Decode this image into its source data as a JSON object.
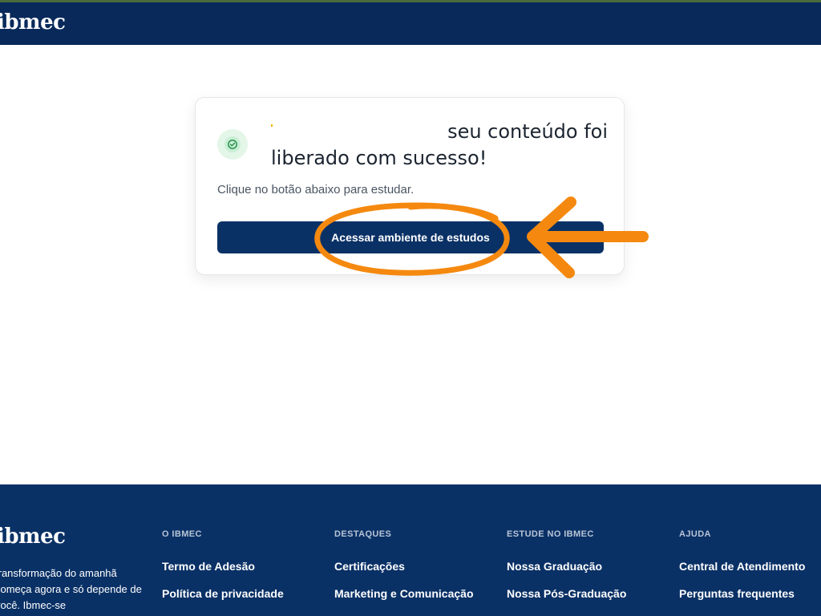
{
  "header": {
    "logo": "ibmec"
  },
  "card": {
    "title_line1": "seu conteúdo foi",
    "title_line2": "liberado com sucesso!",
    "subtitle": "Clique no botão abaixo para estudar.",
    "button_label": "Acessar ambiente de estudos",
    "icon": "check-circle-icon",
    "accent_color": "#0a3166"
  },
  "annotation": {
    "color": "#f5890f",
    "shapes": [
      "ellipse",
      "arrow"
    ]
  },
  "footer": {
    "logo": "ibmec",
    "tagline": "transformação do amanhã começa agora e só depende de você. Ibmec-se",
    "columns": [
      {
        "title": "O IBMEC",
        "links": [
          "Termo de Adesão",
          "Política de privacidade"
        ]
      },
      {
        "title": "DESTAQUES",
        "links": [
          "Certificações",
          "Marketing e Comunicação"
        ]
      },
      {
        "title": "ESTUDE NO IBMEC",
        "links": [
          "Nossa Graduação",
          "Nossa Pós-Graduação"
        ]
      },
      {
        "title": "AJUDA",
        "links": [
          "Central de Atendimento",
          "Perguntas frequentes"
        ]
      }
    ]
  },
  "colors": {
    "header_bg": "#08295a",
    "footer_bg": "#0a3166",
    "button_bg": "#0a3166"
  }
}
